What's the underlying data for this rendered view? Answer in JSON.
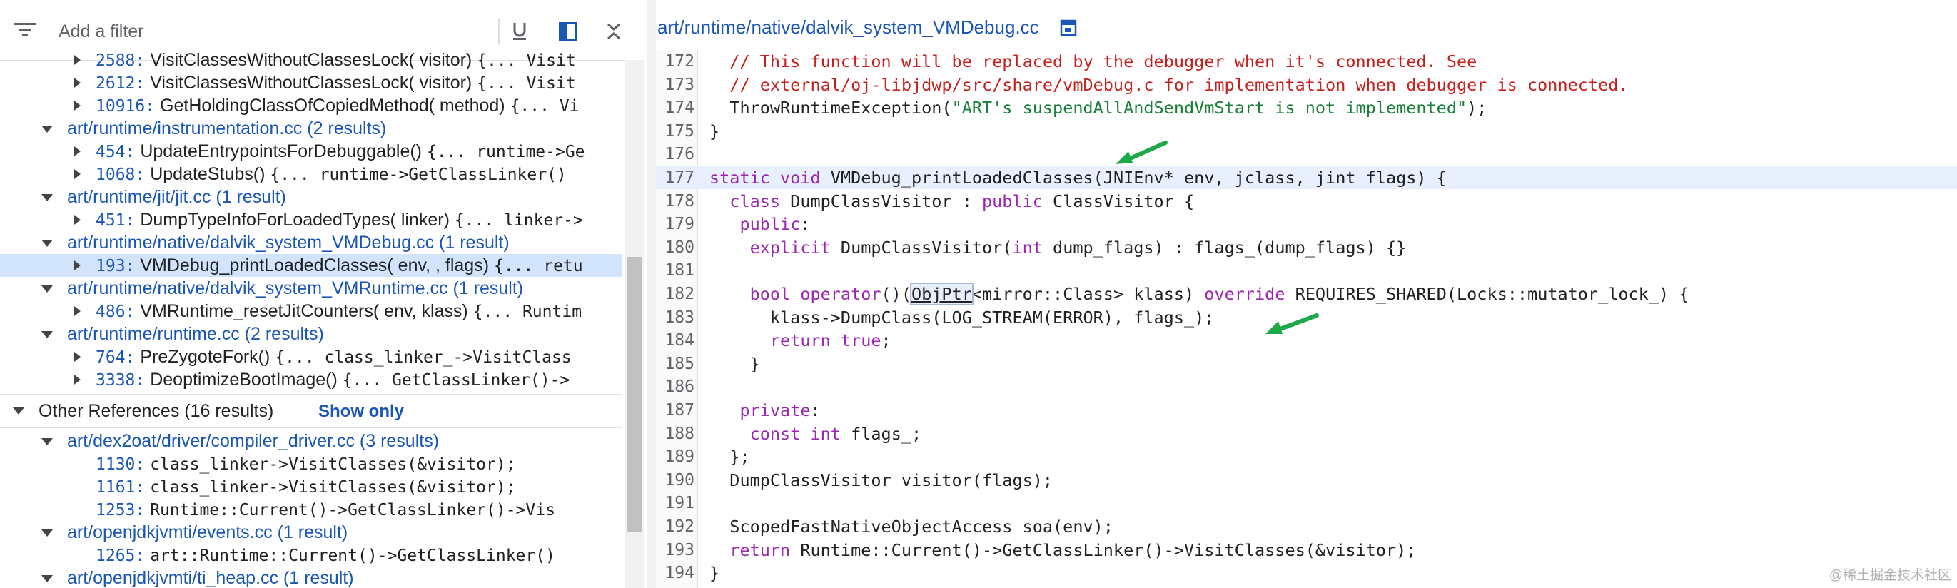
{
  "filter": {
    "placeholder": "Add a filter"
  },
  "toolbar": {
    "icons": [
      "filter-list-icon",
      "underline-icon",
      "side-panel-icon",
      "collapse-all-icon"
    ]
  },
  "results": {
    "rows": [
      {
        "type": "result",
        "line": "2588:",
        "fn": "VisitClassesWithoutClassesLock( visitor)",
        "code": "{... Visit"
      },
      {
        "type": "result",
        "line": "2612:",
        "fn": "VisitClassesWithoutClassesLock( visitor)",
        "code": "{... Visit"
      },
      {
        "type": "result",
        "line": "10916:",
        "fn": "GetHoldingClassOfCopiedMethod( method)",
        "code": "{... Vi"
      },
      {
        "type": "file",
        "path": "art/runtime/instrumentation.cc (2 results)"
      },
      {
        "type": "result",
        "line": "454:",
        "fn": "UpdateEntrypointsForDebuggable()",
        "code": "{... runtime->Ge"
      },
      {
        "type": "result",
        "line": "1068:",
        "fn": "UpdateStubs()",
        "code": "{... runtime->GetClassLinker()"
      },
      {
        "type": "file",
        "path": "art/runtime/jit/jit.cc (1 result)"
      },
      {
        "type": "result",
        "line": "451:",
        "fn": "DumpTypeInfoForLoadedTypes( linker)",
        "code": "{... linker->"
      },
      {
        "type": "file",
        "path": "art/runtime/native/dalvik_system_VMDebug.cc (1 result)"
      },
      {
        "type": "result",
        "selected": true,
        "line": "193:",
        "fn": "VMDebug_printLoadedClasses( env, , flags)",
        "code": "{... retu"
      },
      {
        "type": "file",
        "path": "art/runtime/native/dalvik_system_VMRuntime.cc (1 result)"
      },
      {
        "type": "result",
        "line": "486:",
        "fn": "VMRuntime_resetJitCounters( env, klass)",
        "code": "{... Runtim"
      },
      {
        "type": "file",
        "path": "art/runtime/runtime.cc (2 results)"
      },
      {
        "type": "result",
        "line": "764:",
        "fn": "PreZygoteFork()",
        "code": "{... class_linker_->VisitClass"
      },
      {
        "type": "result",
        "line": "3338:",
        "fn": "DeoptimizeBootImage()",
        "code": "{... GetClassLinker()->"
      }
    ],
    "other_header": {
      "title": "Other References (16 results)",
      "show_only": "Show only"
    },
    "other_rows": [
      {
        "type": "file",
        "path": "art/dex2oat/driver/compiler_driver.cc (3 results)"
      },
      {
        "type": "ref",
        "line": "1130:",
        "code": "class_linker->VisitClasses(&visitor);"
      },
      {
        "type": "ref",
        "line": "1161:",
        "code": "class_linker->VisitClasses(&visitor);"
      },
      {
        "type": "ref",
        "line": "1253:",
        "code": "Runtime::Current()->GetClassLinker()->Vis"
      },
      {
        "type": "file",
        "path": "art/openjdkjvmti/events.cc (1 result)"
      },
      {
        "type": "ref",
        "line": "1265:",
        "code": "art::Runtime::Current()->GetClassLinker()"
      },
      {
        "type": "file",
        "path": "art/openjdkjvmti/ti_heap.cc (1 result)"
      }
    ]
  },
  "editor": {
    "file_path": "art/runtime/native/dalvik_system_VMDebug.cc",
    "lines": [
      {
        "n": "172",
        "text": "  // This function will be replaced by the debugger when it's connected. See"
      },
      {
        "n": "173",
        "text": "  // external/oj-libjdwp/src/share/vmDebug.c for implementation when debugger is connected."
      },
      {
        "n": "174",
        "text": "  ThrowRuntimeException(\"ART's suspendAllAndSendVmStart is not implemented\");"
      },
      {
        "n": "175",
        "text": "}"
      },
      {
        "n": "176",
        "text": ""
      },
      {
        "n": "177",
        "text": "static void VMDebug_printLoadedClasses(JNIEnv* env, jclass, jint flags) {",
        "highlight": true
      },
      {
        "n": "178",
        "text": "  class DumpClassVisitor : public ClassVisitor {"
      },
      {
        "n": "179",
        "text": "   public:"
      },
      {
        "n": "180",
        "text": "    explicit DumpClassVisitor(int dump_flags) : flags_(dump_flags) {}"
      },
      {
        "n": "181",
        "text": ""
      },
      {
        "n": "182",
        "text": "    bool operator()(ObjPtr<mirror::Class> klass) override REQUIRES_SHARED(Locks::mutator_lock_) {"
      },
      {
        "n": "183",
        "text": "      klass->DumpClass(LOG_STREAM(ERROR), flags_);"
      },
      {
        "n": "184",
        "text": "      return true;"
      },
      {
        "n": "185",
        "text": "    }"
      },
      {
        "n": "186",
        "text": ""
      },
      {
        "n": "187",
        "text": "   private:"
      },
      {
        "n": "188",
        "text": "    const int flags_;"
      },
      {
        "n": "189",
        "text": "  };"
      },
      {
        "n": "190",
        "text": "  DumpClassVisitor visitor(flags);"
      },
      {
        "n": "191",
        "text": ""
      },
      {
        "n": "192",
        "text": "  ScopedFastNativeObjectAccess soa(env);"
      },
      {
        "n": "193",
        "text": "  return Runtime::Current()->GetClassLinker()->VisitClasses(&visitor);"
      },
      {
        "n": "194",
        "text": "}"
      }
    ]
  },
  "watermark": "@稀土掘金技术社区",
  "colors": {
    "link": "#1a56b4",
    "comment": "#c5221f",
    "string": "#188038",
    "keyword": "#9c27b0",
    "arrow": "#1fa84a",
    "selection": "#d2e3fc"
  }
}
